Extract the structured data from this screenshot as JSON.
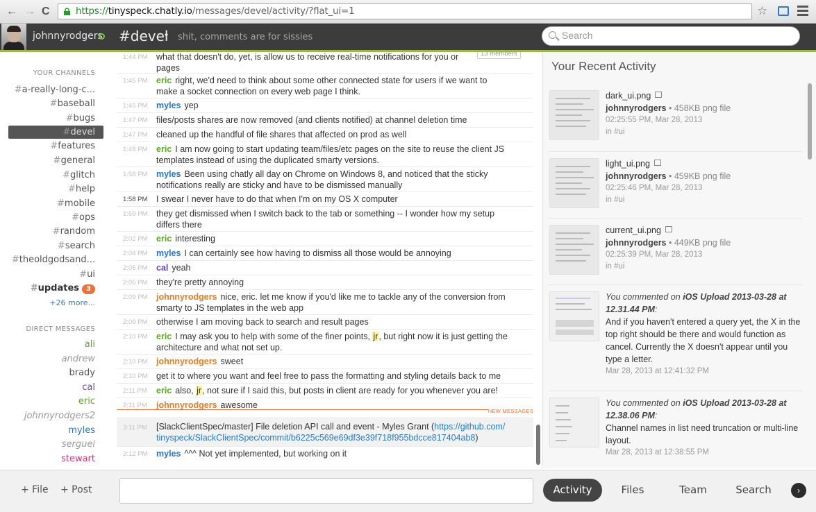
{
  "browser": {
    "url_scheme": "https://",
    "url_host": "tinyspeck.chatly.io",
    "url_path": "/messages/devel/activity/?flat_ui=1",
    "back_icon": "←",
    "forward_icon": "→",
    "reload_icon": "C",
    "star_icon": "☆"
  },
  "header": {
    "username": "johnnyrodgers",
    "channel": "#devel",
    "caret": "▾",
    "topic": "shit, comments are for sissies",
    "search_placeholder": "Search",
    "accent_color": "#9fb74a"
  },
  "sidebar": {
    "channels_heading": "YOUR CHANNELS",
    "channels": [
      {
        "name": "a-really-long-c..."
      },
      {
        "name": "baseball"
      },
      {
        "name": "bugs"
      },
      {
        "name": "devel"
      },
      {
        "name": "features"
      },
      {
        "name": "general"
      },
      {
        "name": "glitch"
      },
      {
        "name": "help"
      },
      {
        "name": "mobile"
      },
      {
        "name": "ops"
      },
      {
        "name": "random"
      },
      {
        "name": "search"
      },
      {
        "name": "theoldgodsand..."
      },
      {
        "name": "ui"
      },
      {
        "name": "updates",
        "badge": "3"
      }
    ],
    "more": "+26 more...",
    "dm_heading": "DIRECT MESSAGES",
    "dms": [
      {
        "name": "ali",
        "color": "#59a81f"
      },
      {
        "name": "andrew",
        "color": "#999999"
      },
      {
        "name": "brady",
        "color": "#555555"
      },
      {
        "name": "cal",
        "color": "#6a41b6"
      },
      {
        "name": "eric",
        "color": "#59a81f"
      },
      {
        "name": "johnnyrodgers2",
        "color": "#999999"
      },
      {
        "name": "myles",
        "color": "#2d75c5"
      },
      {
        "name": "serguei",
        "color": "#999999"
      },
      {
        "name": "stewart",
        "color": "#d2387a"
      }
    ]
  },
  "messages": {
    "members_badge": "13 members",
    "new_messages_label": "NEW MESSAGES",
    "items": [
      {
        "time": "1:44 PM",
        "user": "",
        "text": "what that doesn't do, yet, is allow us to receive real-time notifications for you or",
        "text2": "pages"
      },
      {
        "time": "1:45 PM",
        "user": "eric",
        "text": "right, we'd need to think about some other connected state for users if we want to",
        "text2": "make a socket connection on every web page I think."
      },
      {
        "time": "1:45 PM",
        "user": "myles",
        "text": "yep"
      },
      {
        "time": "1:47 PM",
        "user": "",
        "text": "files/posts shares are now removed (and clients notified) at channel deletion time"
      },
      {
        "time": "1:47 PM",
        "user": "",
        "text": "cleaned up the handful of file shares that affected on prod as well"
      },
      {
        "time": "1:48 PM",
        "user": "eric",
        "text": "I am now going to start updating team/files/etc pages on the site to reuse the client JS",
        "text2": "templates instead of using the duplicated smarty versions."
      },
      {
        "time": "1:58 PM",
        "user": "myles",
        "text": "Been using chatly all day on Chrome on Windows 8, and noticed that the sticky",
        "text2": "notifications really are sticky and have to be dismissed manually"
      },
      {
        "time": "1:58 PM",
        "user": "",
        "text": "I swear I never have to do that when I'm on my OS X computer"
      },
      {
        "time": "1:59 PM",
        "user": "",
        "text": "they get dismissed when I switch back to the tab or something -- I wonder how my setup",
        "text2": "differs there"
      },
      {
        "time": "2:02 PM",
        "user": "eric",
        "text": "interesting"
      },
      {
        "time": "2:04 PM",
        "user": "myles",
        "text": "I can certainly see how having to dismiss all those would be annoying"
      },
      {
        "time": "2:05 PM",
        "user": "cal",
        "text": "yeah"
      },
      {
        "time": "2:05 PM",
        "user": "",
        "text": "they're pretty annoying"
      },
      {
        "time": "2:09 PM",
        "user": "johnnyrodgers",
        "text": "nice, eric. let me know if you'd like me to tackle any of the conversion from",
        "text2": "smarty to JS templates in the web app"
      },
      {
        "time": "2:09 PM",
        "user": "",
        "text": "otherwise I am moving back to search and result pages"
      },
      {
        "time": "2:10 PM",
        "user": "eric",
        "text_pre": "I may ask you to help with some of the finer points, ",
        "mention": "jr",
        "text_post": ", but right now it is just getting the",
        "text2": "architecture and what not set up."
      },
      {
        "time": "2:10 PM",
        "user": "johnnyrodgers",
        "text": "sweet"
      },
      {
        "time": "2:10 PM",
        "user": "",
        "text": "get it to where you want and feel free to pass the formatting and styling details back to me"
      },
      {
        "time": "2:11 PM",
        "user": "eric",
        "text_pre": "also, ",
        "mention": "jr",
        "text_post": ", not sure if I said this, but posts in client are ready for you whenever you are!"
      },
      {
        "time": "2:11 PM",
        "user": "johnnyrodgers",
        "text": "awesome"
      },
      {
        "time": "3:11 PM",
        "user": "",
        "text": "[SlackClientSpec/master] File deletion API call and event - Myles Grant (",
        "link": "https://github.com/",
        "link2": "tinyspeck/SlackClientSpec/commit/b6225c569e69df3e39f718f955bdcce817404ab8",
        "text_post": ")"
      },
      {
        "time": "3:12 PM",
        "user": "myles",
        "text": "^^^ Not yet implemented, but working on it"
      }
    ]
  },
  "activity": {
    "title": "Your Recent Activity",
    "files": [
      {
        "name": "dark_ui.png",
        "owner": "johnnyrodgers",
        "meta": "458KB png file",
        "date": "02:25:55 PM, Mar 28, 2013",
        "channel": "in #ui"
      },
      {
        "name": "light_ui.png",
        "owner": "johnnyrodgers",
        "meta": "459KB png file",
        "date": "02:25:46 PM, Mar 28, 2013",
        "channel": "in #ui"
      },
      {
        "name": "current_ui.png",
        "owner": "johnnyrodgers",
        "meta": "449KB png file",
        "date": "02:25:39 PM, Mar 28, 2013",
        "channel": "in #ui"
      }
    ],
    "comments": [
      {
        "prefix": "You commented on ",
        "target": "iOS Upload 2013-03-28 at 12.31.44 PM",
        "suffix": ":",
        "text": "And if you haven't entered a query yet, the X in the top right should be there and would function as cancel. Currently the X doesn't appear until you type a letter.",
        "date": "Mar 28, 2013 at 12:41:32 PM"
      },
      {
        "prefix": "You commented on ",
        "target": "iOS Upload 2013-03-28 at 12.38.06 PM",
        "suffix": ":",
        "text": "Channel names in list need truncation or multi-line layout.",
        "date": "Mar 28, 2013 at 12:38:55 PM"
      }
    ]
  },
  "footer": {
    "file_btn": "+ File",
    "post_btn": "+ Post",
    "tabs": [
      "Activity",
      "Files",
      "Team",
      "Search"
    ],
    "next_icon": "›"
  }
}
